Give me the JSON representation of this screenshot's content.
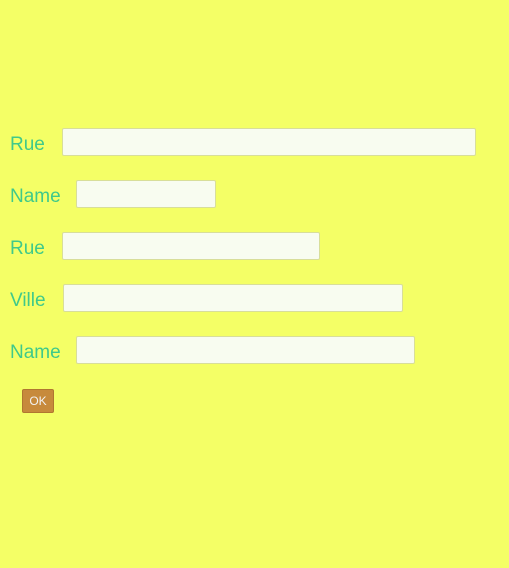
{
  "form": {
    "fields": [
      {
        "label": "Rue",
        "value": "",
        "placeholder": ""
      },
      {
        "label": "Name",
        "value": "",
        "placeholder": ""
      },
      {
        "label": "Rue",
        "value": "",
        "placeholder": ""
      },
      {
        "label": "Ville",
        "value": "",
        "placeholder": ""
      },
      {
        "label": "Name",
        "value": "",
        "placeholder": ""
      }
    ],
    "submit_label": "OK"
  },
  "colors": {
    "background": "#f4ff66",
    "label": "#3fc98a",
    "input_background": "#f8fcf0",
    "button": "#c78a3c"
  }
}
